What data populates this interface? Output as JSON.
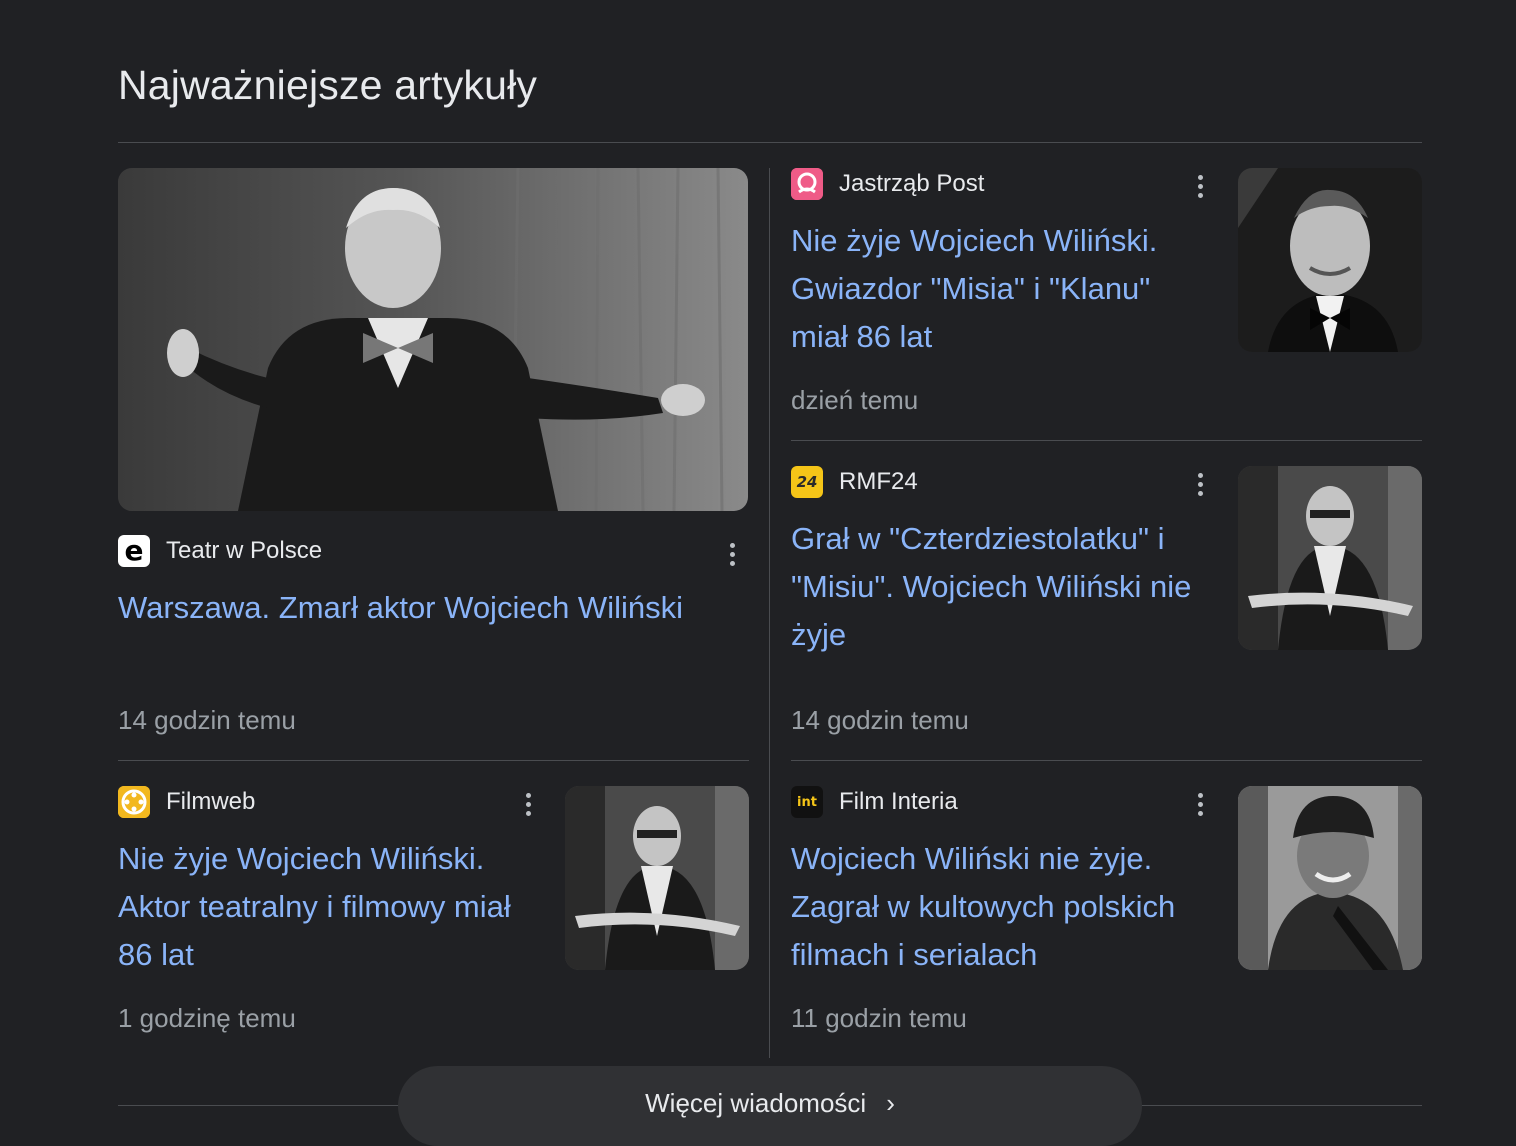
{
  "section": {
    "title": "Najważniejsze artykuły"
  },
  "articles": [
    {
      "source": "Teatr w Polsce",
      "logo_text": "e",
      "logo_bg": "#ffffff",
      "logo_fg": "#000000",
      "headline_lines": [
        "Warszawa. Zmarł aktor Wojciech Wiliński"
      ],
      "time": "14 godzin temu"
    },
    {
      "source": "Jastrząb Post",
      "logo_text": "",
      "logo_bg": "#f06292",
      "logo_fg": "#ffffff",
      "headline_lines": [
        "Nie żyje Wojciech Wiliński.",
        "Gwiazdor \"Misia\" i \"Klanu\"",
        "miał 86 lat"
      ],
      "time": "dzień temu"
    },
    {
      "source": "RMF24",
      "logo_text": "24",
      "logo_bg": "#f5c518",
      "logo_fg": "#2a2a2a",
      "headline_lines": [
        "Grał w \"Czterdziestolatku\" i",
        "\"Misiu\". Wojciech Wiliński nie",
        "żyje"
      ],
      "time": "14 godzin temu"
    },
    {
      "source": "Filmweb",
      "logo_text": "",
      "logo_bg": "#f2b81f",
      "logo_fg": "#ffffff",
      "headline_lines": [
        "Nie żyje Wojciech Wiliński.",
        "Aktor teatralny i filmowy miał",
        "86 lat"
      ],
      "time": "1 godzinę temu"
    },
    {
      "source": "Film Interia",
      "logo_text": "int",
      "logo_bg": "#111111",
      "logo_fg": "#f5c518",
      "headline_lines": [
        "Wojciech Wiliński nie żyje.",
        "Zagrał w kultowych polskich",
        "filmach i serialach"
      ],
      "time": "11 godzin temu"
    }
  ],
  "more_button": {
    "label": "Więcej wiadomości",
    "chevron": "›"
  },
  "colors": {
    "background": "#202124",
    "link": "#8ab4f8",
    "muted": "#9aa0a6",
    "divider": "#4a4c50"
  },
  "icons": [
    "more-vert-icon",
    "chevron-right-icon"
  ]
}
